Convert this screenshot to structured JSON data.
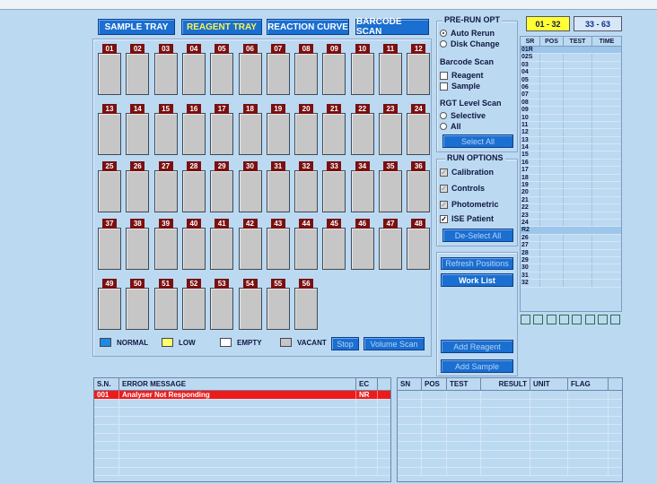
{
  "tabs": [
    {
      "label": "SAMPLE TRAY",
      "active": false
    },
    {
      "label": "REAGENT TRAY",
      "active": true
    },
    {
      "label": "REACTION CURVE",
      "active": false
    },
    {
      "label": "BARCODE SCAN",
      "active": false
    }
  ],
  "tray": {
    "rows": [
      [
        "01",
        "02",
        "03",
        "04",
        "05",
        "06",
        "07",
        "08",
        "09",
        "10",
        "11",
        "12"
      ],
      [
        "13",
        "14",
        "15",
        "16",
        "17",
        "18",
        "19",
        "20",
        "21",
        "22",
        "23",
        "24"
      ],
      [
        "25",
        "26",
        "27",
        "28",
        "29",
        "30",
        "31",
        "32",
        "33",
        "34",
        "35",
        "36"
      ],
      [
        "37",
        "38",
        "39",
        "40",
        "41",
        "42",
        "43",
        "44",
        "45",
        "46",
        "47",
        "48"
      ],
      [
        "49",
        "50",
        "51",
        "52",
        "53",
        "54",
        "55",
        "56"
      ]
    ],
    "slot_status": "vacant"
  },
  "legend": {
    "normal": {
      "label": "NORMAL",
      "color": "#1e8be0"
    },
    "low": {
      "label": "LOW",
      "color": "#ffff66"
    },
    "empty": {
      "label": "EMPTY",
      "color": "#ffffff"
    },
    "vacant": {
      "label": "VACANT",
      "color": "#c6c6c6"
    }
  },
  "buttons": {
    "stop": "Stop",
    "volume_scan": "Volume Scan",
    "select_all": "Select All",
    "deselect_all": "De-Select All",
    "refresh_positions": "Refresh Positions",
    "work_list": "Work List",
    "add_reagent": "Add Reagent",
    "add_sample": "Add Sample"
  },
  "prerun": {
    "title": "PRE-RUN OPT",
    "auto_rerun": "Auto Rerun",
    "disk_change": "Disk Change",
    "barcode_title": "Barcode Scan",
    "reagent": "Reagent",
    "sample": "Sample",
    "rgt_title": "RGT Level Scan",
    "selective": "Selective",
    "all": "All"
  },
  "run_options": {
    "title": "RUN OPTIONS",
    "calibration": "Calibration",
    "controls": "Controls",
    "photometric": "Photometric",
    "ise_patient": "ISE Patient"
  },
  "range_tabs": [
    {
      "label": "01 - 32",
      "active": true
    },
    {
      "label": "33 - 63",
      "active": false
    }
  ],
  "side_table": {
    "headers": [
      "SR",
      "POS",
      "TEST",
      "TIME"
    ],
    "rows": [
      "01R",
      "02S",
      "03",
      "04",
      "05",
      "06",
      "07",
      "08",
      "09",
      "10",
      "11",
      "12",
      "13",
      "14",
      "15",
      "16",
      "17",
      "18",
      "19",
      "20",
      "21",
      "22",
      "23",
      "24",
      "R2",
      "26",
      "27",
      "28",
      "29",
      "30",
      "31",
      "32"
    ],
    "highlight": [
      "01R",
      "R2"
    ]
  },
  "error_table": {
    "headers": [
      "S.N.",
      "ERROR MESSAGE",
      "EC"
    ],
    "rows": [
      {
        "sn": "001",
        "message": "Analyser Not Responding",
        "ec": "NR"
      }
    ]
  },
  "result_table": {
    "headers": [
      "SN",
      "POS",
      "TEST",
      "RESULT",
      "UNIT",
      "FLAG"
    ]
  },
  "colors": {
    "background": "#bcd9f2",
    "button": "#1a6fd0",
    "slot_label": "#7a1010",
    "error_row": "#ee1b1b",
    "range_tab_active": "#ffff33"
  }
}
